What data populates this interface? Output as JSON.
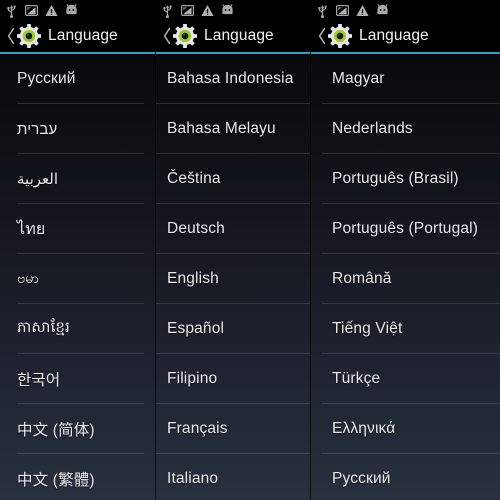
{
  "window": {
    "title": "Language",
    "accent_color": "#2a9fd4",
    "background_top": "#070709",
    "background_bottom": "#2a303e",
    "text_color": "#e9e9ec"
  },
  "statusbar": {
    "icons": [
      {
        "name": "usb-icon"
      },
      {
        "name": "screenshot-icon"
      },
      {
        "name": "warning-triangle-icon"
      },
      {
        "name": "android-robot-icon"
      }
    ]
  },
  "panels": [
    {
      "id": "panel-1",
      "actionbar": {
        "back_label": "‹",
        "icon": "settings-gear-icon",
        "title": "Language"
      },
      "items": [
        {
          "label": "Русский",
          "script": "cyrillic"
        },
        {
          "label": "עברית",
          "script": "hebrew"
        },
        {
          "label": "العربية",
          "script": "arabic"
        },
        {
          "label": "ไทย",
          "script": "thai"
        },
        {
          "label": "ဗမာ",
          "script": "myanmar"
        },
        {
          "label": "ភាសាខ្មែរ",
          "script": "khmer"
        },
        {
          "label": "한국어",
          "script": "hangul"
        },
        {
          "label": "中文 (简体)",
          "script": "han"
        },
        {
          "label": "中文 (繁體)",
          "script": "han"
        }
      ]
    },
    {
      "id": "panel-2",
      "actionbar": {
        "back_label": "‹",
        "icon": "settings-gear-icon",
        "title": "Language"
      },
      "items": [
        {
          "label": "Bahasa Indonesia",
          "script": "latin"
        },
        {
          "label": "Bahasa Melayu",
          "script": "latin"
        },
        {
          "label": "Čeština",
          "script": "latin"
        },
        {
          "label": "Deutsch",
          "script": "latin"
        },
        {
          "label": "English",
          "script": "latin"
        },
        {
          "label": "Español",
          "script": "latin"
        },
        {
          "label": "Filipino",
          "script": "latin"
        },
        {
          "label": "Français",
          "script": "latin"
        },
        {
          "label": "Italiano",
          "script": "latin"
        }
      ]
    },
    {
      "id": "panel-3",
      "actionbar": {
        "back_label": "‹",
        "icon": "settings-gear-icon",
        "title": "Language"
      },
      "items": [
        {
          "label": "Magyar",
          "script": "latin"
        },
        {
          "label": "Nederlands",
          "script": "latin"
        },
        {
          "label": "Português (Brasil)",
          "script": "latin"
        },
        {
          "label": "Português (Portugal)",
          "script": "latin"
        },
        {
          "label": "Română",
          "script": "latin"
        },
        {
          "label": "Tiếng Việt",
          "script": "latin"
        },
        {
          "label": "Türkçe",
          "script": "latin"
        },
        {
          "label": "Ελληνικά",
          "script": "greek"
        },
        {
          "label": "Русский",
          "script": "cyrillic"
        }
      ]
    }
  ]
}
